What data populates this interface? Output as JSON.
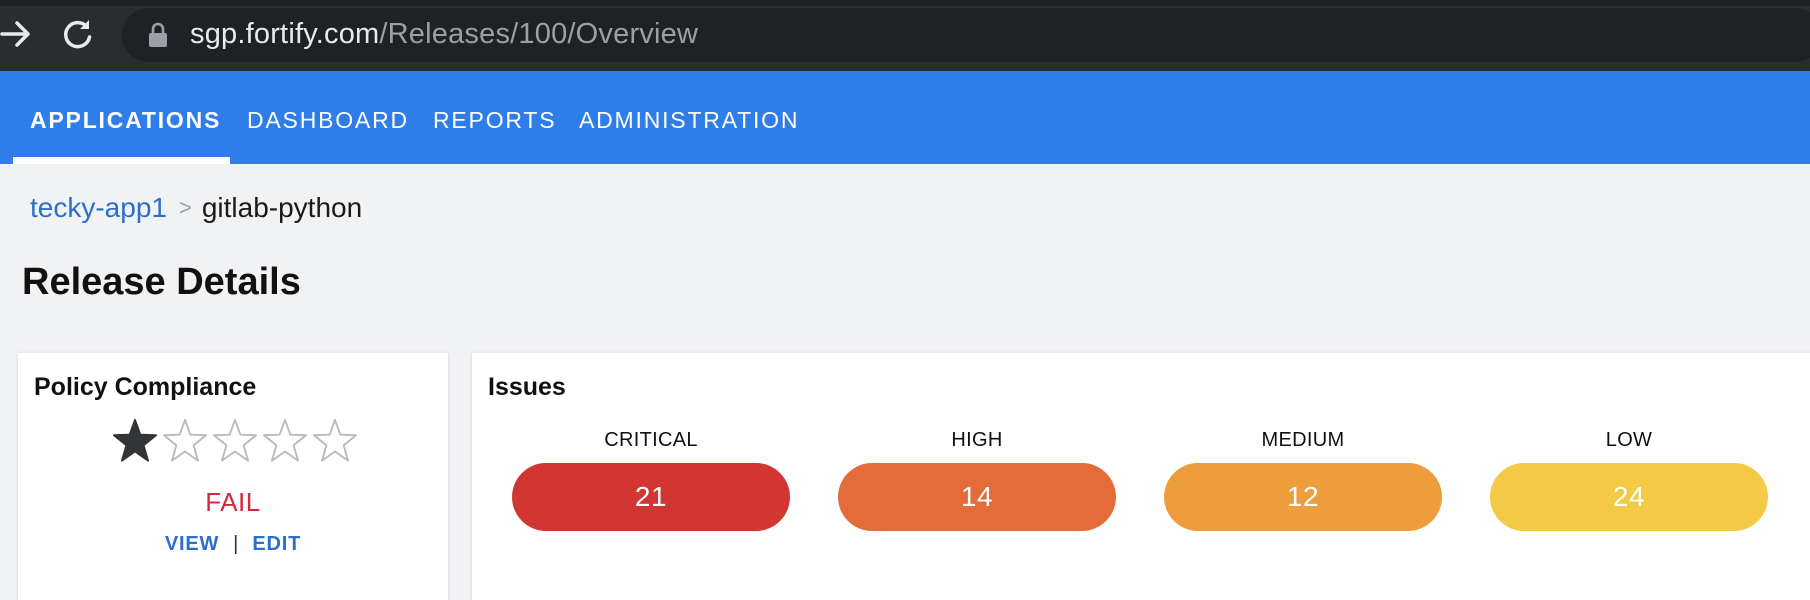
{
  "browser": {
    "url_host": "sgp.fortify.com",
    "url_path": "/Releases/100/Overview"
  },
  "nav": {
    "items": [
      {
        "label": "APPLICATIONS",
        "active": true
      },
      {
        "label": "DASHBOARD",
        "active": false
      },
      {
        "label": "REPORTS",
        "active": false
      },
      {
        "label": "ADMINISTRATION",
        "active": false
      }
    ]
  },
  "breadcrumb": {
    "parent": "tecky-app1",
    "separator": ">",
    "current": "gitlab-python"
  },
  "page": {
    "title": "Release Details"
  },
  "policy": {
    "title": "Policy Compliance",
    "rating": 1,
    "rating_max": 5,
    "status": "FAIL",
    "view_label": "VIEW",
    "separator": "|",
    "edit_label": "EDIT"
  },
  "issues": {
    "title": "Issues",
    "severities": [
      {
        "label": "CRITICAL",
        "count": "21",
        "color": "#d13632"
      },
      {
        "label": "HIGH",
        "count": "14",
        "color": "#e36c3a"
      },
      {
        "label": "MEDIUM",
        "count": "12",
        "color": "#ee9d3d"
      },
      {
        "label": "LOW",
        "count": "24",
        "color": "#f4c945"
      }
    ]
  },
  "colors": {
    "nav_bg": "#2f7de8",
    "link": "#2a6fc9",
    "fail": "#d2293d"
  }
}
